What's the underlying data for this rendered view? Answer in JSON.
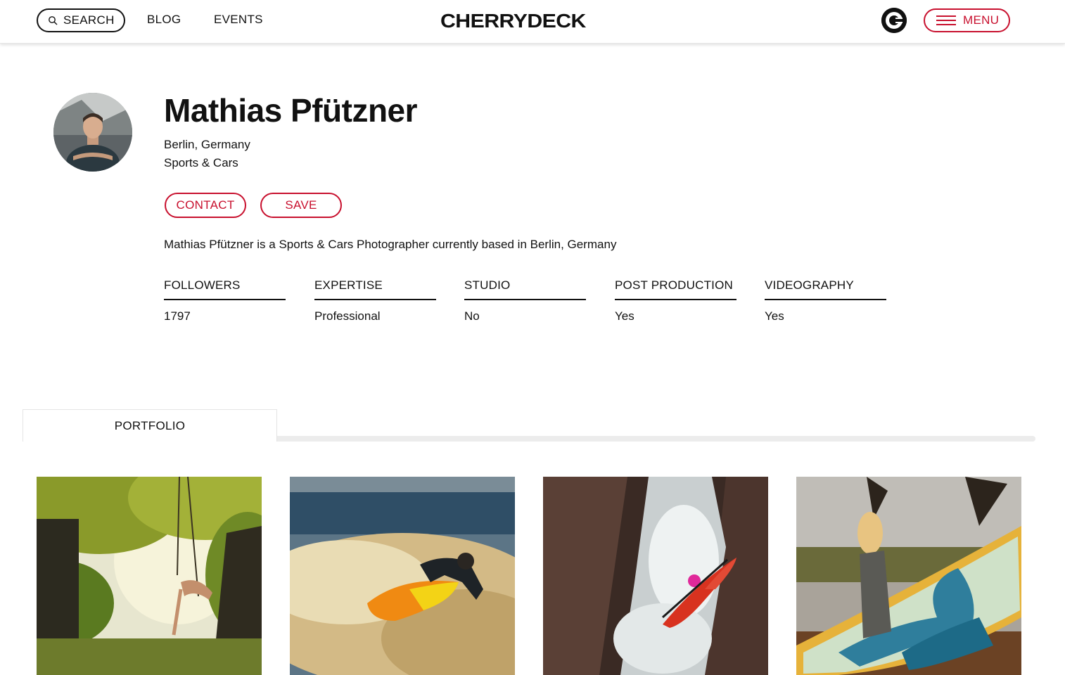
{
  "header": {
    "search_label": "SEARCH",
    "nav": [
      "BLOG",
      "EVENTS"
    ],
    "logo": "CHERRYDECK",
    "menu_label": "MENU",
    "accent": "#c8102e"
  },
  "profile": {
    "name": "Mathias Pfützner",
    "location": "Berlin, Germany",
    "specialty": "Sports & Cars",
    "contact_label": "CONTACT",
    "save_label": "SAVE",
    "bio": "Mathias Pfützner is a Sports & Cars Photographer currently based in Berlin, Germany",
    "stats": [
      {
        "label": "FOLLOWERS",
        "value": "1797"
      },
      {
        "label": "EXPERTISE",
        "value": "Professional"
      },
      {
        "label": "STUDIO",
        "value": "No"
      },
      {
        "label": "POST PRODUCTION",
        "value": "Yes"
      },
      {
        "label": "VIDEOGRAPHY",
        "value": "Yes"
      }
    ]
  },
  "tabs": {
    "active": "PORTFOLIO"
  },
  "icons": {
    "search": "search-icon",
    "menu": "hamburger-icon",
    "brand": "cherrydeck-mark-icon"
  }
}
